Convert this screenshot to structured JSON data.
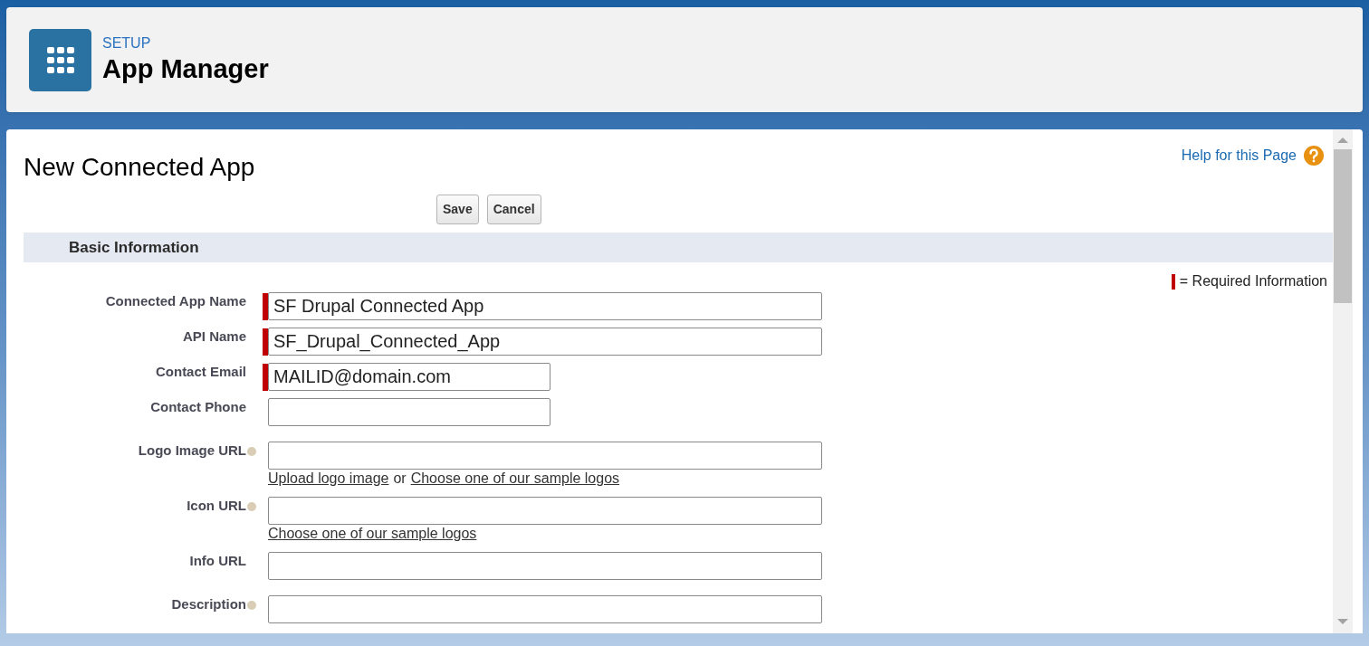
{
  "header": {
    "eyebrow": "SETUP",
    "title": "App Manager"
  },
  "page": {
    "title": "New Connected App",
    "help_link": "Help for this Page"
  },
  "buttons": [
    "Save",
    "Cancel"
  ],
  "section": {
    "title": "Basic Information",
    "legend": "= Required Information"
  },
  "fields": [
    {
      "label": "Connected App Name",
      "value": "SF Drupal Connected App",
      "required": true,
      "help": false,
      "kind": "wide"
    },
    {
      "label": "API Name",
      "value": "SF_Drupal_Connected_App",
      "required": true,
      "help": false,
      "kind": "wide"
    },
    {
      "label": "Contact Email",
      "value": "MAILID@domain.com",
      "required": true,
      "help": false,
      "kind": "short"
    },
    {
      "label": "Contact Phone",
      "required": false,
      "help": false,
      "kind": "short"
    },
    {
      "label": "Logo Image URL",
      "required": false,
      "help": true,
      "kind": "wide",
      "links": [
        {
          "kind": "link",
          "text": "Upload logo image"
        },
        {
          "kind": "plain",
          "text": "or"
        },
        {
          "kind": "link",
          "text": "Choose one of our sample logos"
        }
      ]
    },
    {
      "label": "Icon URL",
      "required": false,
      "help": true,
      "kind": "wide",
      "links": [
        {
          "kind": "link",
          "text": "Choose one of our sample logos"
        }
      ]
    },
    {
      "label": "Info URL",
      "required": false,
      "help": false,
      "kind": "wide"
    },
    {
      "label": "Description",
      "required": false,
      "help": true,
      "kind": "wide"
    }
  ]
}
